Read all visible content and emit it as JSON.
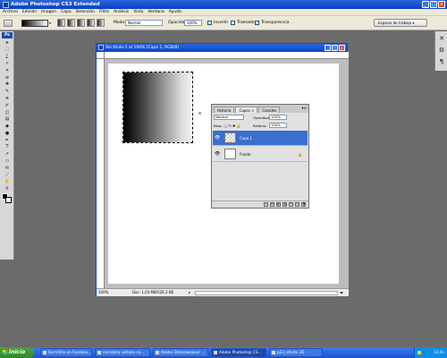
{
  "app": {
    "title": "Adobe Photoshop CS3 Extended",
    "window_buttons": [
      "_",
      "□",
      "x"
    ]
  },
  "menu": [
    "Archivo",
    "Edición",
    "Imagen",
    "Capa",
    "Selección",
    "Filtro",
    "Análisis",
    "Vista",
    "Ventana",
    "Ayuda"
  ],
  "options": {
    "gradient_dropdown": "▾",
    "mode_label": "Modo:",
    "mode_value": "Normal",
    "opacity_label": "Opacidad:",
    "opacity_value": "100%",
    "invert_label": "Invertir",
    "dither_label": "Tramado",
    "transparency_label": "Transparencia",
    "workspace_label": "Espacio de trabajo ▾"
  },
  "tools": {
    "logo": "Ps",
    "icons": [
      "move-icon",
      "marquee-icon",
      "lasso-icon",
      "magic-wand-icon",
      "crop-icon",
      "slice-icon",
      "healing-icon",
      "brush-icon",
      "stamp-icon",
      "history-brush-icon",
      "eraser-icon",
      "gradient-icon",
      "blur-icon",
      "dodge-icon",
      "pen-icon",
      "type-icon",
      "path-select-icon",
      "shape-icon",
      "notes-icon",
      "eyedropper-icon",
      "hand-icon",
      "zoom-icon"
    ],
    "glyphs": [
      "➤",
      "⬚",
      "ʆ",
      "✧",
      "⌗",
      "⧄",
      "✚",
      "✎",
      "⎈",
      "✐",
      "◫",
      "▤",
      "◆",
      "●",
      "✒",
      "T",
      "➚",
      "▭",
      "✉",
      "⟋",
      "✋",
      "⚲"
    ]
  },
  "dock": {
    "icons": [
      "✕",
      "⚙",
      "¶"
    ]
  },
  "document": {
    "title": "Sin título-1 al 100% (Capa 1, RGB/8)",
    "zoom": "100%",
    "doc_info": "Doc: 1,03 MB/526,3 KB",
    "window_buttons": [
      "_",
      "□",
      "x"
    ],
    "arrow": "▸",
    "scroll_arrow": "◂▸"
  },
  "layers_panel": {
    "tabs": [
      "Historia",
      "Capas ×",
      "Canales"
    ],
    "menu_icon": "▾≡",
    "blend_mode": "Normal",
    "opacity_label": "Opacidad:",
    "opacity_value": "100%",
    "lock_label": "Bloq.:",
    "fill_label": "Relleno:",
    "fill_value": "100%",
    "layers": [
      {
        "name": "Capa 1",
        "active": true
      },
      {
        "name": "Fondo",
        "active": false,
        "locked": true
      }
    ],
    "eye_icon": "👁",
    "lock_icon": "🔒",
    "bottom_icons": [
      "∞",
      "fx",
      "◐",
      "◑",
      "▭",
      "❏",
      "🗑"
    ]
  },
  "taskbar": {
    "start": "Inicio",
    "tasks": [
      "FarmVille en Faceboo...",
      "carretera sultana co...",
      "Adobe Dreamweaver ...",
      "Adobe Photoshop CS...",
      "p23_efecto 3D"
    ],
    "active_task_index": 3,
    "time": "12:41"
  }
}
